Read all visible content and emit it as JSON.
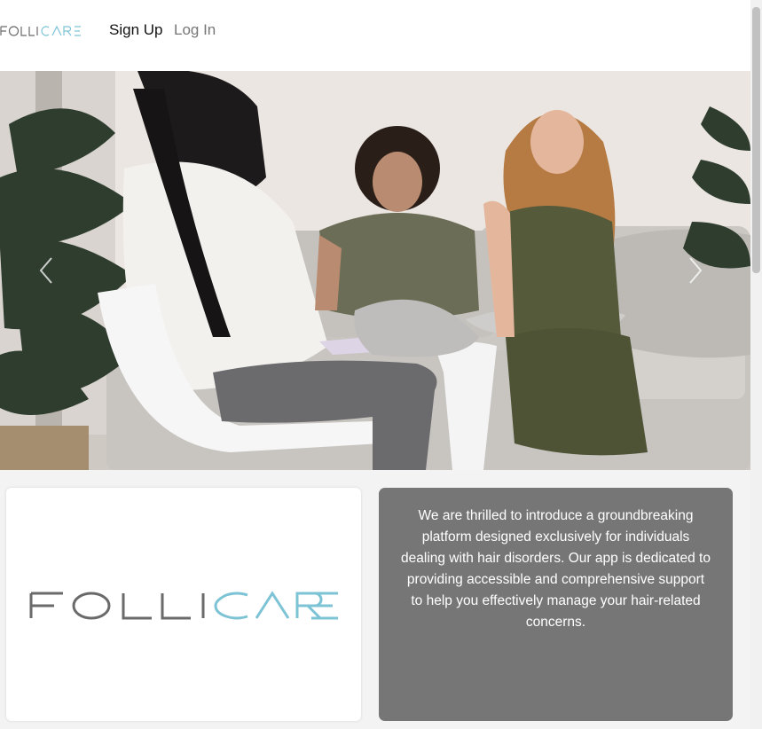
{
  "nav": {
    "brand": "FOLLICARE",
    "signup": "Sign Up",
    "login": "Log In"
  },
  "hero": {
    "prev_icon": "chevron-left-icon",
    "next_icon": "chevron-right-icon"
  },
  "logo_card": {
    "brand": "FOLLICARE",
    "brand_dark_part": "FOLLI",
    "brand_accent_part": "CARE",
    "colors": {
      "dark": "#6a6a6a",
      "accent": "#7cc3d6"
    }
  },
  "intro": {
    "text": "We are thrilled to introduce a groundbreaking platform designed exclusively for individuals dealing with hair disorders. Our app is dedicated to providing accessible and comprehensive support to help you effectively manage your hair-related concerns."
  },
  "colors": {
    "card_gray": "#767676",
    "nav_text": "#111111",
    "nav_muted": "#777777"
  }
}
